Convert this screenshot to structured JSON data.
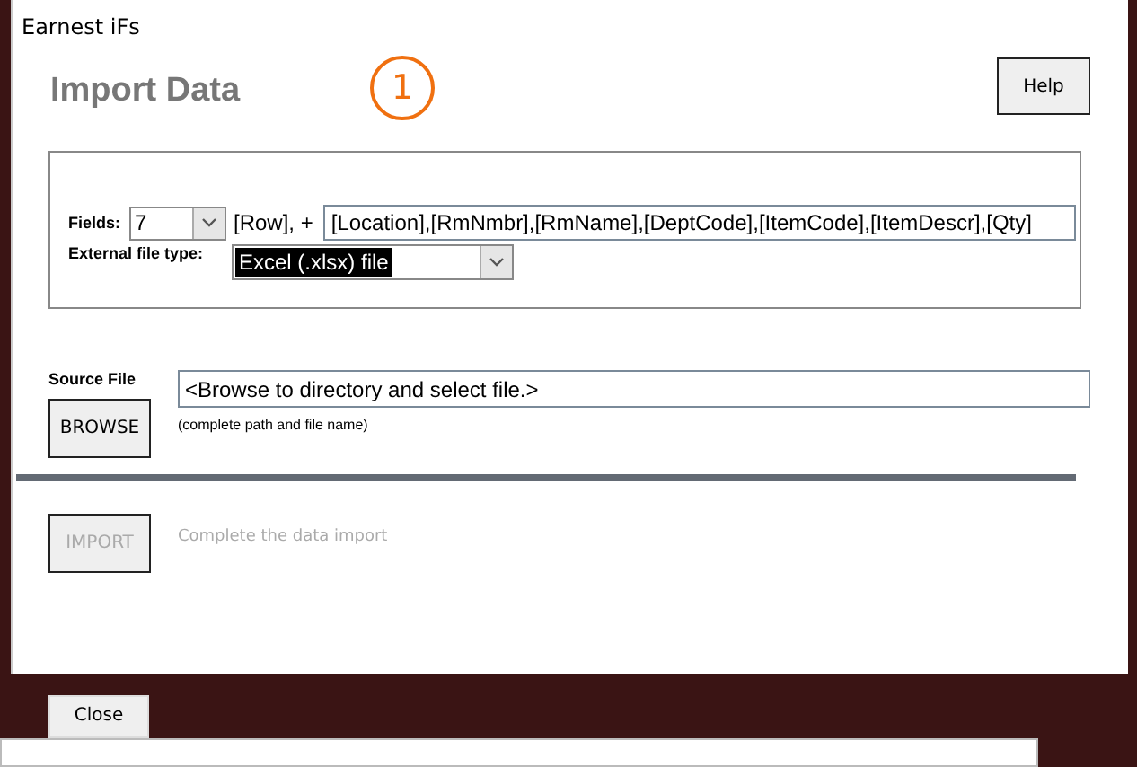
{
  "window": {
    "title": "Earnest iFs"
  },
  "heading": "Import Data",
  "annotation": {
    "label": "1"
  },
  "help_button": "Help",
  "fields": {
    "label": "Fields:",
    "count": "7",
    "prefix": "[Row], +",
    "list": "[Location],[RmNmbr],[RmName],[DeptCode],[ItemCode],[ItemDescr],[Qty]"
  },
  "file_type": {
    "label": "External file type:",
    "value": "Excel (.xlsx) file",
    "selected": true
  },
  "source_file": {
    "label": "Source File",
    "value": "<Browse to directory and select file.>",
    "hint": "(complete path and file name)",
    "button": "BROWSE"
  },
  "import": {
    "button": "IMPORT",
    "disabled": true,
    "description": "Complete the data import"
  },
  "close_button": "Close"
}
